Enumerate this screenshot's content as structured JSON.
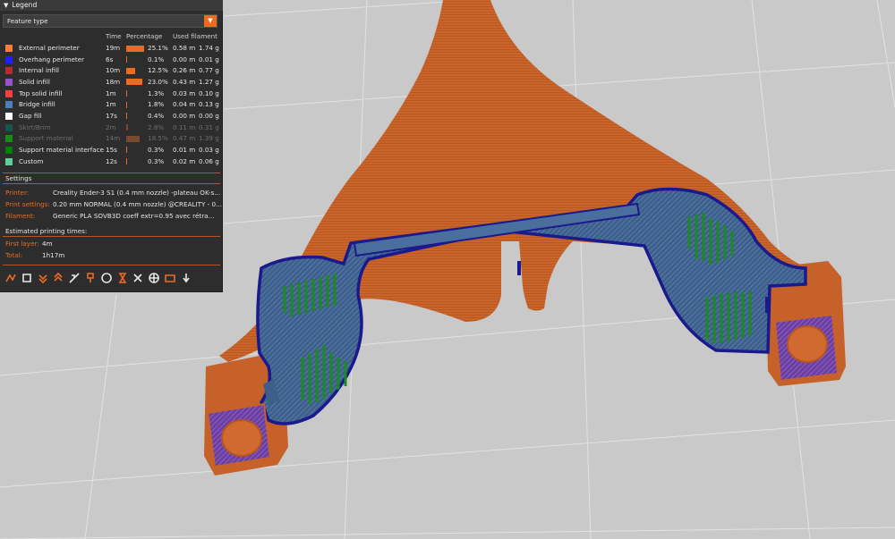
{
  "legend": {
    "title": "Legend",
    "view_type": "Feature type",
    "columns": {
      "time": "Time",
      "percentage": "Percentage",
      "used_filament": "Used filament"
    },
    "features": [
      {
        "name": "External perimeter",
        "time": "19m",
        "percentage": 25.1,
        "percentage_label": "25.1%",
        "length": "0.58 m",
        "weight": "1.74 g",
        "color": "#ff7d38",
        "enabled": true
      },
      {
        "name": "Overhang perimeter",
        "time": "6s",
        "percentage": 0.1,
        "percentage_label": "0.1%",
        "length": "0.00 m",
        "weight": "0.01 g",
        "color": "#1f1fff",
        "enabled": true
      },
      {
        "name": "Internal infill",
        "time": "10m",
        "percentage": 12.5,
        "percentage_label": "12.5%",
        "length": "0.26 m",
        "weight": "0.77 g",
        "color": "#b03029",
        "enabled": true
      },
      {
        "name": "Solid infill",
        "time": "18m",
        "percentage": 23.0,
        "percentage_label": "23.0%",
        "length": "0.43 m",
        "weight": "1.27 g",
        "color": "#9654cc",
        "enabled": true
      },
      {
        "name": "Top solid infill",
        "time": "1m",
        "percentage": 1.3,
        "percentage_label": "1.3%",
        "length": "0.03 m",
        "weight": "0.10 g",
        "color": "#f04040",
        "enabled": true
      },
      {
        "name": "Bridge infill",
        "time": "1m",
        "percentage": 1.8,
        "percentage_label": "1.8%",
        "length": "0.04 m",
        "weight": "0.13 g",
        "color": "#4d80ba",
        "enabled": true
      },
      {
        "name": "Gap fill",
        "time": "17s",
        "percentage": 0.4,
        "percentage_label": "0.4%",
        "length": "0.00 m",
        "weight": "0.00 g",
        "color": "#ffffff",
        "enabled": true
      },
      {
        "name": "Skirt/Brim",
        "time": "2m",
        "percentage": 2.8,
        "percentage_label": "2.8%",
        "length": "0.11 m",
        "weight": "0.31 g",
        "color": "#00876e",
        "enabled": false
      },
      {
        "name": "Support material",
        "time": "14m",
        "percentage": 18.5,
        "percentage_label": "18.5%",
        "length": "0.47 m",
        "weight": "1.39 g",
        "color": "#00ff00",
        "enabled": false
      },
      {
        "name": "Support material interface",
        "time": "15s",
        "percentage": 0.3,
        "percentage_label": "0.3%",
        "length": "0.01 m",
        "weight": "0.03 g",
        "color": "#008000",
        "enabled": true
      },
      {
        "name": "Custom",
        "time": "12s",
        "percentage": 0.3,
        "percentage_label": "0.3%",
        "length": "0.02 m",
        "weight": "0.06 g",
        "color": "#5ed194",
        "enabled": true
      }
    ],
    "settings": {
      "title": "Settings",
      "printer_label": "Printer:",
      "printer": "Creality Ender-3 S1 (0.4 mm nozzle) -plateau OK-s...",
      "print_settings_label": "Print settings:",
      "print_settings": "0.20 mm NORMAL (0.4 mm nozzle) @CREALITY - 0...",
      "filament_label": "Filament:",
      "filament": "Generic PLA  SOVB3D coeff extr=0.95 avec rétra..."
    },
    "times": {
      "title": "Estimated printing times:",
      "first_layer_label": "First layer:",
      "first_layer": "4m",
      "total_label": "Total:",
      "total": "1h17m"
    },
    "toolbar": [
      {
        "icon": "travel-icon",
        "color": "#ed6b21"
      },
      {
        "icon": "wipe-icon",
        "color": "#e8e8e8"
      },
      {
        "icon": "retractions-icon",
        "color": "#ed6b21"
      },
      {
        "icon": "deretractions-icon",
        "color": "#ed6b21"
      },
      {
        "icon": "seams-icon",
        "color": "#e8e8e8"
      },
      {
        "icon": "tool-changes-icon",
        "color": "#ed6b21"
      },
      {
        "icon": "color-changes-icon",
        "color": "#e8e8e8"
      },
      {
        "icon": "pause-prints-icon",
        "color": "#ed6b21"
      },
      {
        "icon": "custom-gcodes-icon",
        "color": "#e8e8e8"
      },
      {
        "icon": "center-of-gravity-icon",
        "color": "#e8e8e8"
      },
      {
        "icon": "shells-icon",
        "color": "#ed6b21"
      },
      {
        "icon": "tool-marker-icon",
        "color": "#e8e8e8"
      }
    ]
  }
}
